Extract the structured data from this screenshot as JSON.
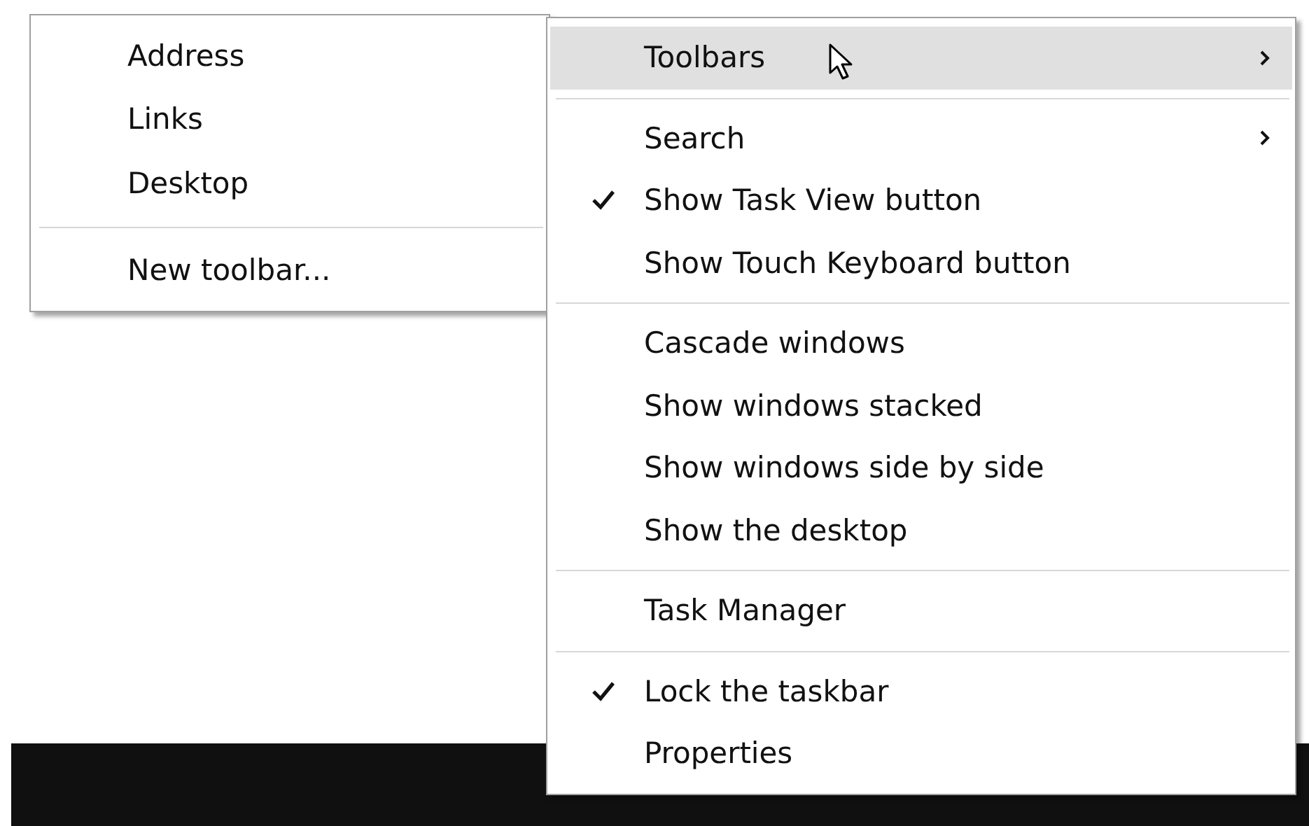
{
  "toolbars_submenu": {
    "groups": [
      [
        {
          "label": "Address",
          "selected": false
        },
        {
          "label": "Links",
          "selected": false
        },
        {
          "label": "Desktop",
          "selected": false
        }
      ],
      [
        {
          "label": "New toolbar...",
          "selected": false
        }
      ]
    ]
  },
  "taskbar_menu": {
    "groups": [
      [
        {
          "label": "Toolbars",
          "checked": false,
          "submenu": true,
          "selected": true
        }
      ],
      [
        {
          "label": "Search",
          "checked": false,
          "submenu": true,
          "selected": false
        },
        {
          "label": "Show Task View button",
          "checked": true,
          "submenu": false,
          "selected": false
        },
        {
          "label": "Show Touch Keyboard button",
          "checked": false,
          "submenu": false,
          "selected": false
        }
      ],
      [
        {
          "label": "Cascade windows",
          "checked": false,
          "submenu": false,
          "selected": false
        },
        {
          "label": "Show windows stacked",
          "checked": false,
          "submenu": false,
          "selected": false
        },
        {
          "label": "Show windows side by side",
          "checked": false,
          "submenu": false,
          "selected": false
        },
        {
          "label": "Show the desktop",
          "checked": false,
          "submenu": false,
          "selected": false
        }
      ],
      [
        {
          "label": "Task Manager",
          "checked": false,
          "submenu": false,
          "selected": false
        }
      ],
      [
        {
          "label": "Lock the taskbar",
          "checked": true,
          "submenu": false,
          "selected": false
        },
        {
          "label": "Properties",
          "checked": false,
          "submenu": false,
          "selected": false
        }
      ]
    ]
  }
}
